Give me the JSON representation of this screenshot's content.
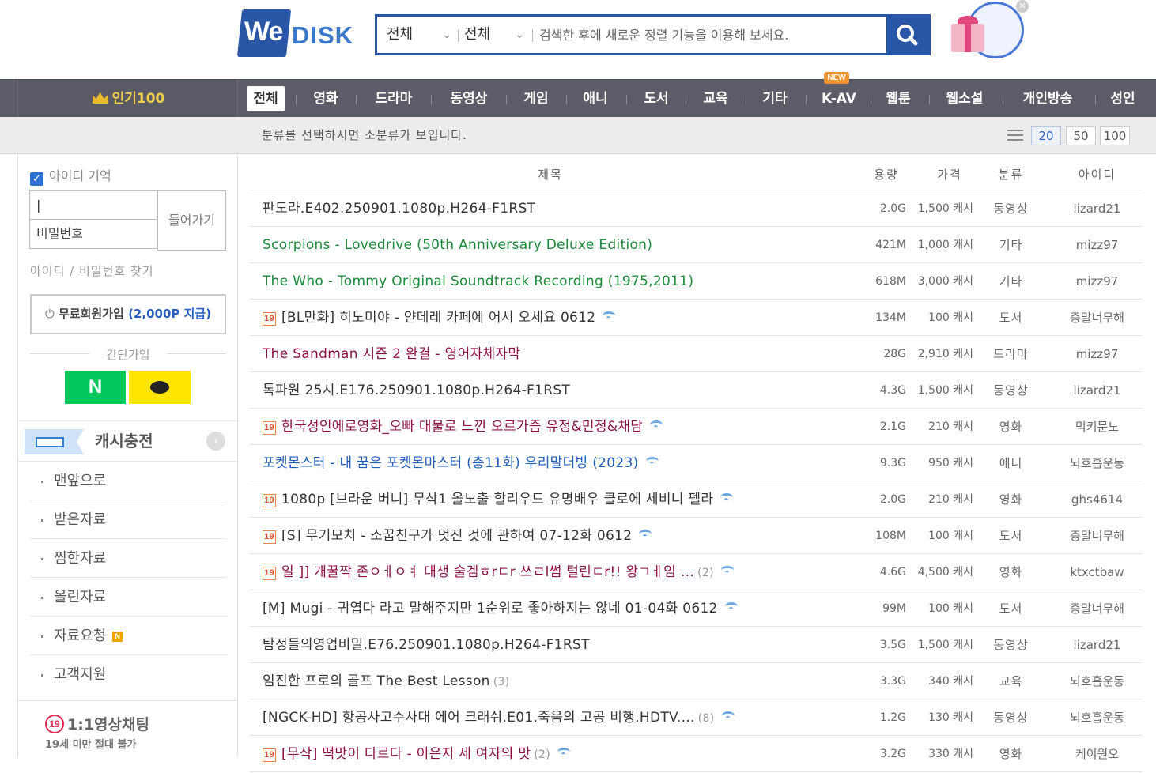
{
  "header": {
    "logo_we": "We",
    "logo_disk": "DISK",
    "search": {
      "scope1": "전체",
      "scope2": "전체",
      "placeholder": "검색한 후에 새로운 정렬 기능을 이용해 보세요."
    }
  },
  "nav": {
    "popular": "인기100",
    "items": [
      {
        "label": "전체",
        "active": true
      },
      {
        "label": "영화"
      },
      {
        "label": "드라마"
      },
      {
        "label": "동영상"
      },
      {
        "label": "게임"
      },
      {
        "label": "애니"
      },
      {
        "label": "도서"
      },
      {
        "label": "교육"
      },
      {
        "label": "기타"
      },
      {
        "label": "K-AV",
        "badge": "NEW"
      },
      {
        "label": "웹툰"
      },
      {
        "label": "웹소설"
      },
      {
        "label": "개인방송"
      },
      {
        "label": "성인"
      }
    ],
    "new_badge": "NEW"
  },
  "subbar": {
    "message": "분류를 선택하시면 소분류가 보입니다.",
    "page_sizes": [
      "20",
      "50",
      "100"
    ],
    "selected_page_size": "20"
  },
  "sidebar": {
    "remember_id": "아이디 기억",
    "id_value": "|",
    "password_placeholder": "비밀번호",
    "login_button": "들어가기",
    "find_link": "아이디 / 비밀번호 찾기",
    "join_button": "무료회원가입",
    "join_bonus": "(2,000P 지급)",
    "quick_join": "간단가입",
    "naver_label": "N",
    "cash_charge": "캐시충전",
    "menu": [
      {
        "label": "맨앞으로"
      },
      {
        "label": "받은자료"
      },
      {
        "label": "찜한자료"
      },
      {
        "label": "올린자료"
      },
      {
        "label": "자료요청",
        "badge": "N"
      },
      {
        "label": "고객지원"
      }
    ],
    "chat_badge": "19",
    "chat_title": "1:1영상채팅",
    "chat_notice": "19세 미만 절대 불가"
  },
  "table": {
    "headers": {
      "title": "제목",
      "size": "용량",
      "price": "가격",
      "category": "분류",
      "uploader": "아이디"
    },
    "rows": [
      {
        "title": "판도라.E402.250901.1080p.H264-F1RST",
        "color": "def",
        "adult": false,
        "wifi": false,
        "count": "",
        "size": "2.0G",
        "price": "1,500 캐시",
        "category": "동영상",
        "uploader": "lizard21"
      },
      {
        "title": "Scorpions - Lovedrive (50th Anniversary Deluxe Edition)",
        "color": "green",
        "adult": false,
        "wifi": false,
        "count": "",
        "size": "421M",
        "price": "1,000 캐시",
        "category": "기타",
        "uploader": "mizz97"
      },
      {
        "title": "The Who - Tommy Original Soundtrack Recording (1975,2011)",
        "color": "green",
        "adult": false,
        "wifi": false,
        "count": "",
        "size": "618M",
        "price": "3,000 캐시",
        "category": "기타",
        "uploader": "mizz97"
      },
      {
        "title": "[BL만화] 히노미야 - 얀데레 카페에 어서 오세요 0612",
        "color": "def",
        "adult": true,
        "wifi": true,
        "count": "",
        "size": "134M",
        "price": "100 캐시",
        "category": "도서",
        "uploader": "증말너무해"
      },
      {
        "title": "The Sandman 시즌 2 완결 - 영어자체자막",
        "color": "red",
        "adult": false,
        "wifi": false,
        "count": "",
        "size": "28G",
        "price": "2,910 캐시",
        "category": "드라마",
        "uploader": "mizz97"
      },
      {
        "title": "톡파원 25시.E176.250901.1080p.H264-F1RST",
        "color": "def",
        "adult": false,
        "wifi": false,
        "count": "",
        "size": "4.3G",
        "price": "1,500 캐시",
        "category": "동영상",
        "uploader": "lizard21"
      },
      {
        "title": "한국성인에로영화_오빠 대물로 느낀 오르가즘 유정&민정&채담",
        "color": "red",
        "adult": true,
        "wifi": true,
        "count": "",
        "size": "2.1G",
        "price": "210 캐시",
        "category": "영화",
        "uploader": "믹키문노"
      },
      {
        "title": "포켓몬스터 - 내 꿈은 포켓몬마스터 (총11화) 우리말더빙 (2023)",
        "color": "blue",
        "adult": false,
        "wifi": true,
        "count": "",
        "size": "9.3G",
        "price": "950 캐시",
        "category": "애니",
        "uploader": "뇌호흡운동"
      },
      {
        "title": "1080p [브라운 버니] 무삭1 올노출 할리우드 유명배우 클로에 세비니 펠라",
        "color": "def",
        "adult": true,
        "wifi": true,
        "count": "",
        "size": "2.0G",
        "price": "210 캐시",
        "category": "영화",
        "uploader": "ghs4614"
      },
      {
        "title": "[S] 무기모치 - 소꿉친구가 멋진 것에 관하여 07-12화 0612",
        "color": "def",
        "adult": true,
        "wifi": true,
        "count": "",
        "size": "108M",
        "price": "100 캐시",
        "category": "도서",
        "uploader": "증말너무해"
      },
      {
        "title": "일 ]] 개꿀짝 존ㅇㅔㅇㅕ 대생 술겜ㅎrㄷr 쓰ㄹl썸 털린ㄷr!! 왕ㄱㅔ임 …",
        "color": "red",
        "adult": true,
        "wifi": true,
        "count": "(2)",
        "size": "4.6G",
        "price": "4,500 캐시",
        "category": "영화",
        "uploader": "ktxctbaw"
      },
      {
        "title": "[M] Mugi - 귀엽다 라고 말해주지만 1순위로 좋아하지는 않네 01-04화 0612",
        "color": "def",
        "adult": false,
        "wifi": true,
        "count": "",
        "size": "99M",
        "price": "100 캐시",
        "category": "도서",
        "uploader": "증말너무해"
      },
      {
        "title": "탐정들의영업비밀.E76.250901.1080p.H264-F1RST",
        "color": "def",
        "adult": false,
        "wifi": false,
        "count": "",
        "size": "3.5G",
        "price": "1,500 캐시",
        "category": "동영상",
        "uploader": "lizard21"
      },
      {
        "title": "임진한 프로의 골프 The Best Lesson",
        "color": "def",
        "adult": false,
        "wifi": false,
        "count": "(3)",
        "size": "3.3G",
        "price": "340 캐시",
        "category": "교육",
        "uploader": "뇌호흡운동"
      },
      {
        "title": "[NGCK-HD] 항공사고수사대 에어 크래쉬.E01.죽음의 고공 비행.HDTV.…",
        "color": "def",
        "adult": false,
        "wifi": true,
        "count": "(8)",
        "size": "1.2G",
        "price": "130 캐시",
        "category": "동영상",
        "uploader": "뇌호흡운동"
      },
      {
        "title": "[무삭] 떡맛이 다르다 - 이은지 세 여자의 맛",
        "color": "red",
        "adult": true,
        "wifi": true,
        "count": "(2)",
        "size": "3.2G",
        "price": "330 캐시",
        "category": "영화",
        "uploader": "케이원오"
      }
    ]
  }
}
